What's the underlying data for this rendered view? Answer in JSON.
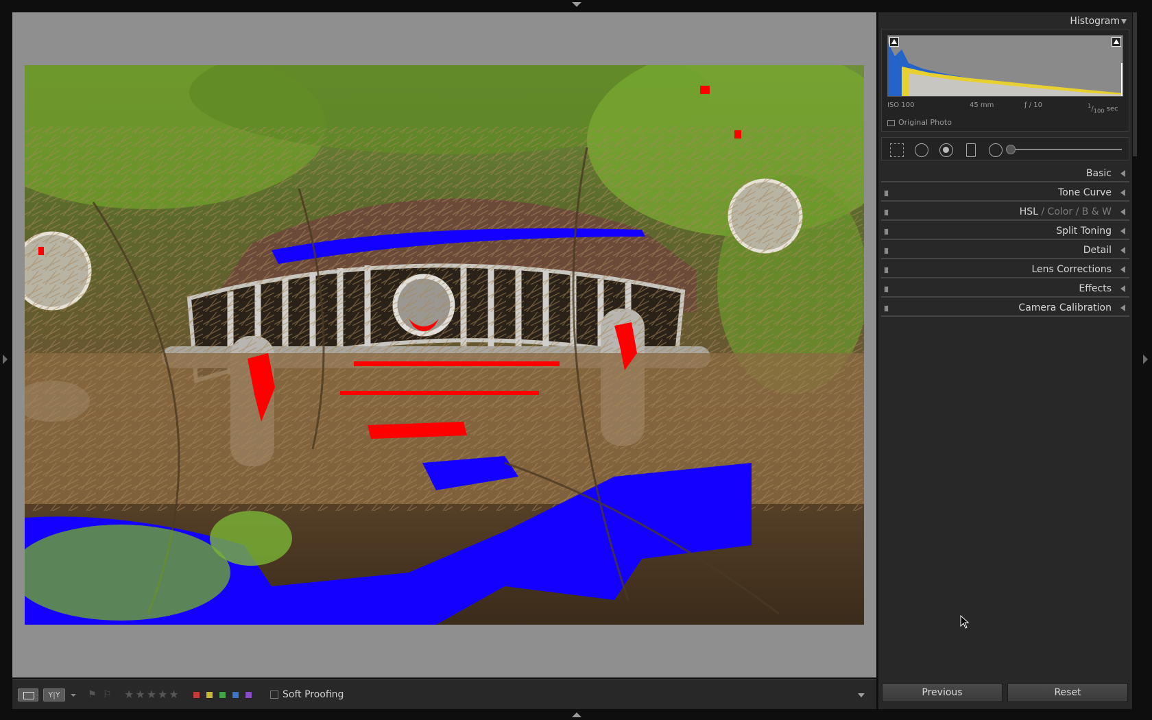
{
  "histogram_panel": {
    "title": "Histogram",
    "exif": {
      "iso": "ISO 100",
      "focal_length": "45 mm",
      "aperture": "ƒ / 10",
      "shutter_num": "1",
      "shutter_den": "100",
      "shutter_unit": "sec"
    },
    "original_photo_label": "Original Photo"
  },
  "panels": {
    "basic": "Basic",
    "tone_curve": "Tone Curve",
    "hsl": "HSL",
    "separator": "/",
    "color": "Color",
    "bw": "B & W",
    "split_toning": "Split Toning",
    "detail": "Detail",
    "lens_corrections": "Lens Corrections",
    "effects": "Effects",
    "camera_calibration": "Camera Calibration"
  },
  "toolbar": {
    "compare_label": "Y|Y",
    "stars": "★★★★★",
    "soft_proofing": "Soft Proofing",
    "swatch_colors": [
      "#c8393a",
      "#c8b730",
      "#3fa544",
      "#3a73c8",
      "#8a4bc8"
    ]
  },
  "buttons": {
    "previous": "Previous",
    "reset": "Reset"
  },
  "colors": {
    "clip_shadow": "#1400ff",
    "clip_highlight": "#ff0000",
    "panel_bg": "#282828",
    "view_bg": "#8f8f8f"
  }
}
